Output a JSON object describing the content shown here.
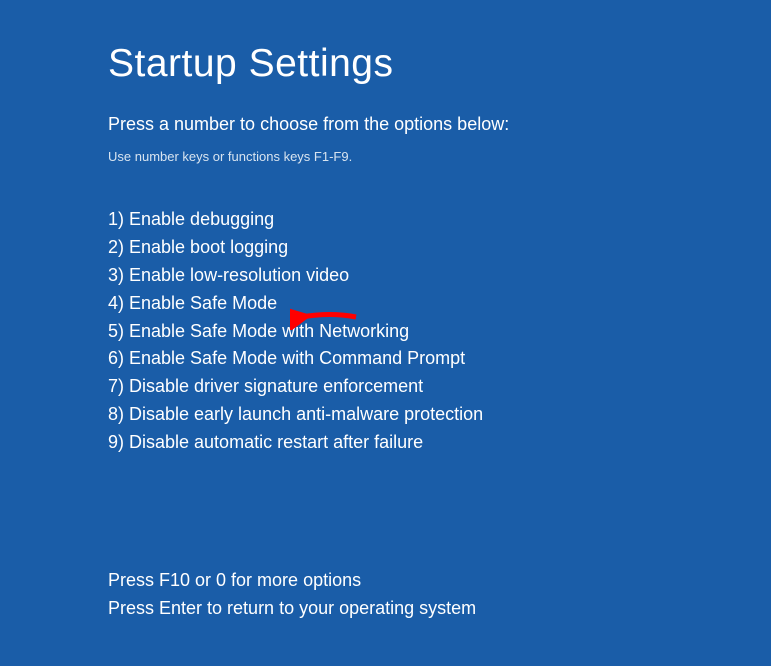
{
  "title": "Startup Settings",
  "instruction": "Press a number to choose from the options below:",
  "subinstruction": "Use number keys or functions keys F1-F9.",
  "options": [
    {
      "num": "1",
      "label": "Enable debugging"
    },
    {
      "num": "2",
      "label": "Enable boot logging"
    },
    {
      "num": "3",
      "label": "Enable low-resolution video"
    },
    {
      "num": "4",
      "label": "Enable Safe Mode"
    },
    {
      "num": "5",
      "label": "Enable Safe Mode with Networking"
    },
    {
      "num": "6",
      "label": "Enable Safe Mode with Command Prompt"
    },
    {
      "num": "7",
      "label": "Disable driver signature enforcement"
    },
    {
      "num": "8",
      "label": "Disable early launch anti-malware protection"
    },
    {
      "num": "9",
      "label": "Disable automatic restart after failure"
    }
  ],
  "footer": {
    "line1": "Press F10 or 0 for more options",
    "line2": "Press Enter to return to your operating system"
  },
  "annotation": {
    "arrow_target_index": 3
  }
}
